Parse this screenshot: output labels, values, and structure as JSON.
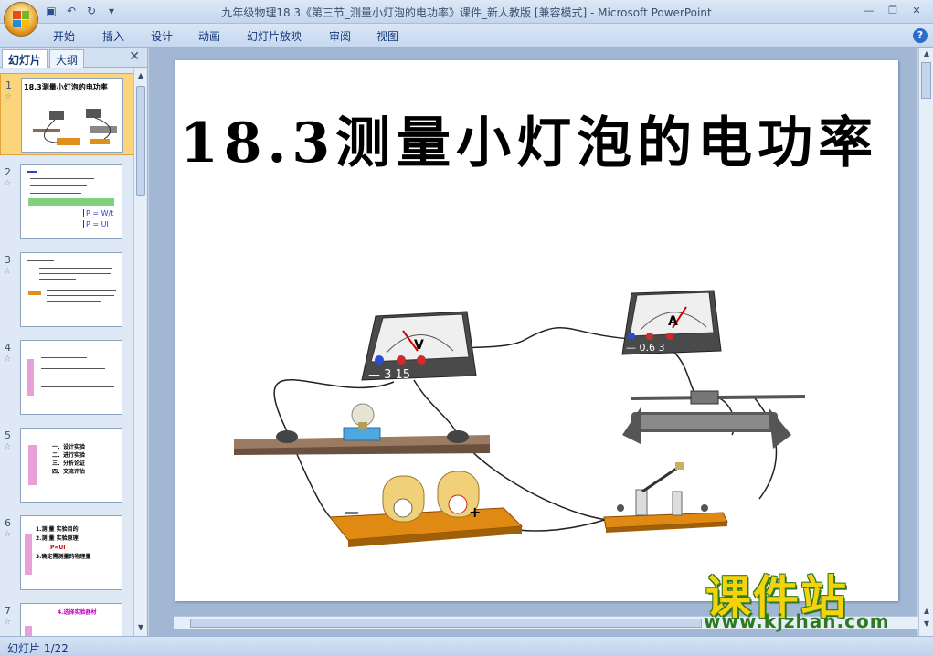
{
  "window": {
    "title": "九年级物理18.3《第三节_测量小灯泡的电功率》课件_新人教版 [兼容模式] - Microsoft PowerPoint"
  },
  "ribbon": {
    "tabs": [
      "开始",
      "插入",
      "设计",
      "动画",
      "幻灯片放映",
      "审阅",
      "视图"
    ]
  },
  "panel": {
    "tab_slides": "幻灯片",
    "tab_outline": "大纲",
    "thumbnails": [
      {
        "num": "1",
        "title": "18.3测量小灯泡的电功率"
      },
      {
        "num": "2",
        "formula1": "P = W/t",
        "formula2": "P = UI"
      },
      {
        "num": "3"
      },
      {
        "num": "4"
      },
      {
        "num": "5",
        "items": [
          "一．设计实验",
          "二．进行实验",
          "三．分析论证",
          "四．交流评估"
        ]
      },
      {
        "num": "6",
        "items": [
          "1.测 量 实验目的",
          "2.测 量 实验原理",
          "P=UI",
          "3.确定需测量的物理量"
        ]
      },
      {
        "num": "7",
        "item": "4.选择实验器材"
      }
    ]
  },
  "slide": {
    "title": "18.3测量小灯泡的电功率",
    "voltmeter_label": "V",
    "voltmeter_terminals": "— 3 15",
    "ammeter_label": "A",
    "ammeter_terminals": "— 0.6 3",
    "battery_neg": "—",
    "battery_pos": "+"
  },
  "status": {
    "slide_counter": "幻灯片 1/22"
  },
  "watermark": {
    "name": "课件站",
    "url": "www.kjzhan.com"
  },
  "colors": {
    "ribbon_text": "#15387a",
    "selected_thumb": "#fbd57c",
    "slide_bg": "#ffffff",
    "watermark_yellow": "#f4d20c",
    "watermark_green": "#2d7a1e"
  }
}
